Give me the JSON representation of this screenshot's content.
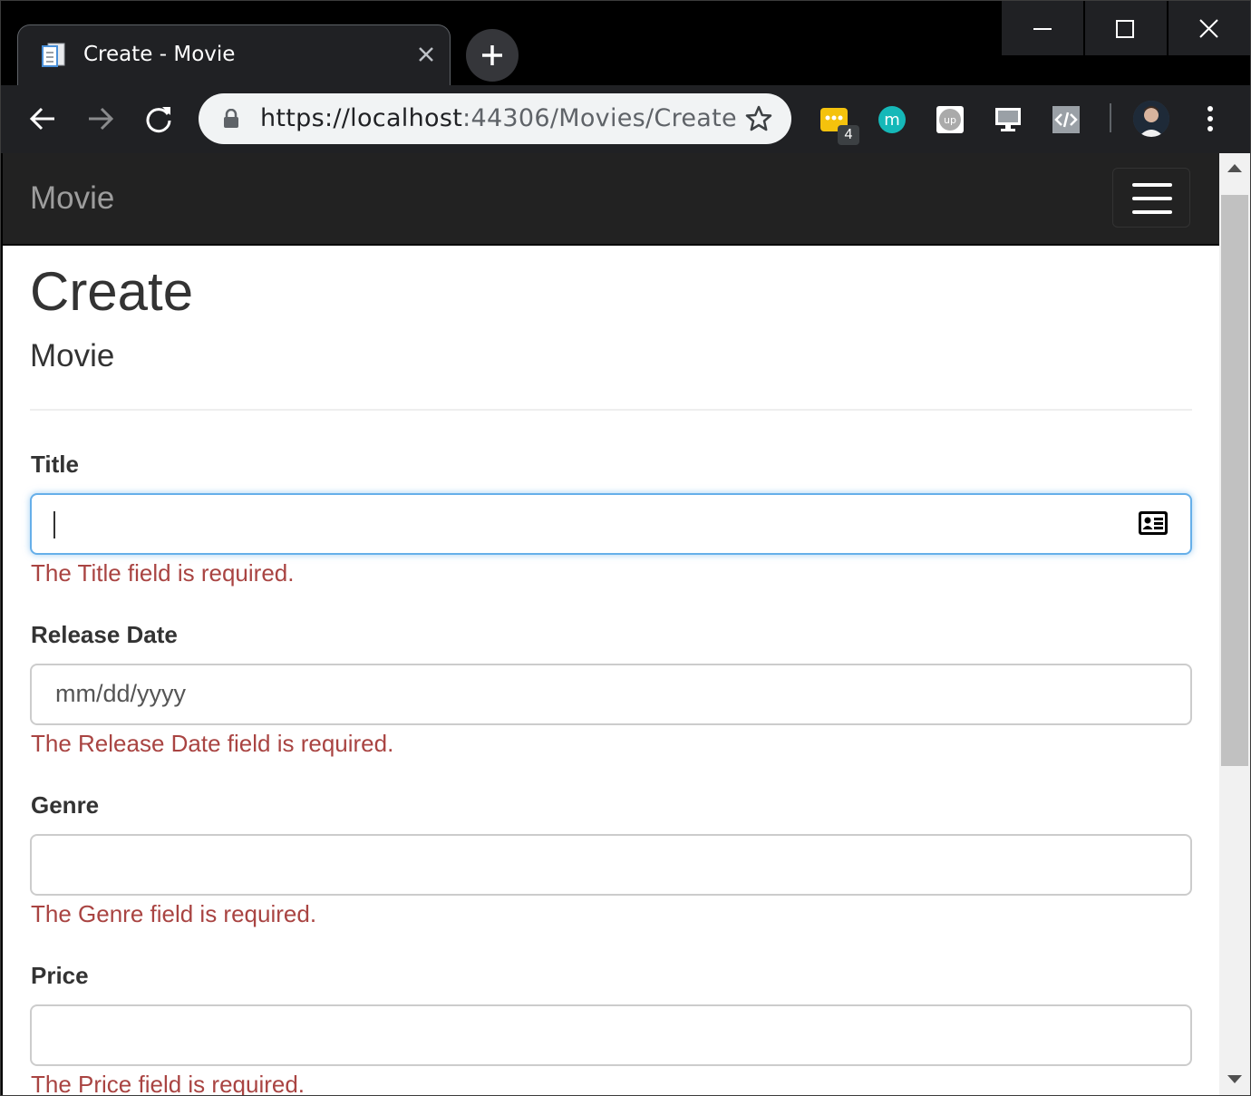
{
  "browser": {
    "tab_title": "Create - Movie",
    "url_host": "https://localhost",
    "url_path": ":44306/Movies/Create",
    "extension_badge": "4"
  },
  "navbar": {
    "brand": "Movie"
  },
  "page": {
    "heading": "Create",
    "subheading": "Movie"
  },
  "form": {
    "title": {
      "label": "Title",
      "value": "",
      "error": "The Title field is required."
    },
    "release_date": {
      "label": "Release Date",
      "placeholder": "mm/dd/yyyy",
      "error": "The Release Date field is required."
    },
    "genre": {
      "label": "Genre",
      "value": "",
      "error": "The Genre field is required."
    },
    "price": {
      "label": "Price",
      "value": "",
      "error": "The Price field is required."
    }
  },
  "colors": {
    "error": "#a94442",
    "focus": "#66afe9",
    "navbar": "#222222"
  }
}
